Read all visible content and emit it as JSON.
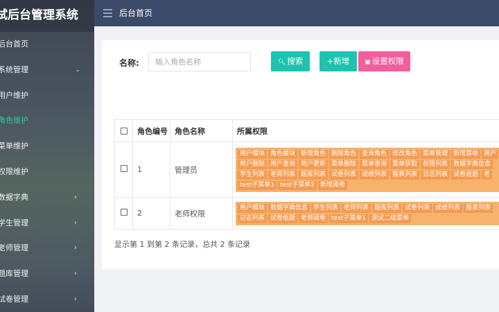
{
  "brand": {
    "title": "试后台管理系统"
  },
  "topbar": {
    "menu_icon": "hamburger-icon",
    "title": "后台首页"
  },
  "sidebar": {
    "items": [
      {
        "label": "后台首页",
        "arrow": ""
      },
      {
        "label": "系统管理",
        "arrow": "⌄"
      },
      {
        "label": "用户维护",
        "arrow": ""
      },
      {
        "label": "角色维护",
        "arrow": "",
        "active": true
      },
      {
        "label": "菜单维护",
        "arrow": ""
      },
      {
        "label": "权限维护",
        "arrow": ""
      },
      {
        "label": "数据字典",
        "arrow": "›"
      },
      {
        "label": "学生管理",
        "arrow": "›"
      },
      {
        "label": "老师管理",
        "arrow": "›"
      },
      {
        "label": "题库管理",
        "arrow": "›"
      },
      {
        "label": "试卷管理",
        "arrow": "›"
      }
    ],
    "colors": {
      "active": "#2ecb9c",
      "text": "#f2f2f2"
    }
  },
  "search": {
    "label": "名称:",
    "placeholder": "输入角色名称",
    "search_button": "搜索",
    "add_button": "+新增",
    "perm_button": "设置权限",
    "search_icon": "search-icon",
    "perm_icon": "settings-icon"
  },
  "table": {
    "headers": {
      "id": "角色编号",
      "name": "角色名称",
      "perms": "所属权限"
    },
    "rows": [
      {
        "id": "1",
        "name": "管理员",
        "tags": [
          "用户模块",
          "角色模块",
          "新增角色",
          "删除角色",
          "查询角色",
          "修改角色",
          "菜单管理",
          "新增菜单",
          "用户",
          "用户删除",
          "用户查询",
          "用户更新",
          "菜单删除",
          "菜单查询",
          "菜单获取",
          "权限列表",
          "数据字典信息",
          "学生列表",
          "老师列表",
          "题库列表",
          "试卷列表",
          "成绩列表",
          "报表列表",
          "日志列表",
          "试卷组题",
          "老",
          "test子菜单1",
          "test子菜单2",
          "新增阅卷"
        ]
      },
      {
        "id": "2",
        "name": "老师权限",
        "tags": [
          "用户模块",
          "数据字典信息",
          "学生列表",
          "老师列表",
          "题库列表",
          "试卷列表",
          "成绩列表",
          "报表列表",
          "日志列表",
          "试卷组题",
          "老师阅卷",
          "test子菜单1",
          "测试二级菜单"
        ]
      }
    ]
  },
  "footer": {
    "info": "显示第 1 到第 2 条记录，总共 2 条记录"
  },
  "colors": {
    "teal": "#1ec3b0",
    "pink": "#f15e9e",
    "tag": "#f49b52",
    "topbar": "#3c4a69"
  }
}
